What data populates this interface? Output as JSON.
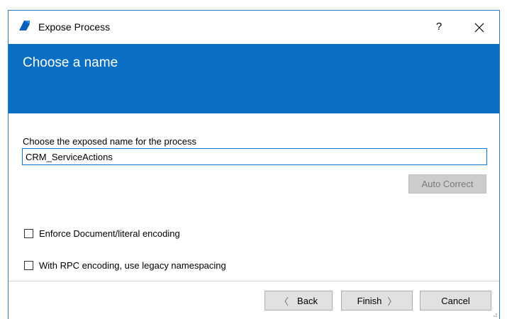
{
  "window": {
    "title": "Expose Process",
    "help_label": "?",
    "close_label": "✕"
  },
  "banner": {
    "title": "Choose a name"
  },
  "form": {
    "name_label": "Choose the exposed name for the process",
    "name_value": "CRM_ServiceActions",
    "auto_correct_label": "Auto Correct",
    "checkboxes": [
      {
        "label": "Enforce Document/literal encoding",
        "checked": false
      },
      {
        "label": "With RPC encoding, use legacy namespacing",
        "checked": false
      }
    ]
  },
  "footer": {
    "back_label": "Back",
    "finish_label": "Finish",
    "cancel_label": "Cancel",
    "back_arrow": "〈",
    "finish_arrow": "〉"
  },
  "colors": {
    "banner": "#0a6fc2",
    "window_border": "#2b78c5",
    "input_border": "#0a78d7",
    "disabled_button": "#cccccc"
  }
}
